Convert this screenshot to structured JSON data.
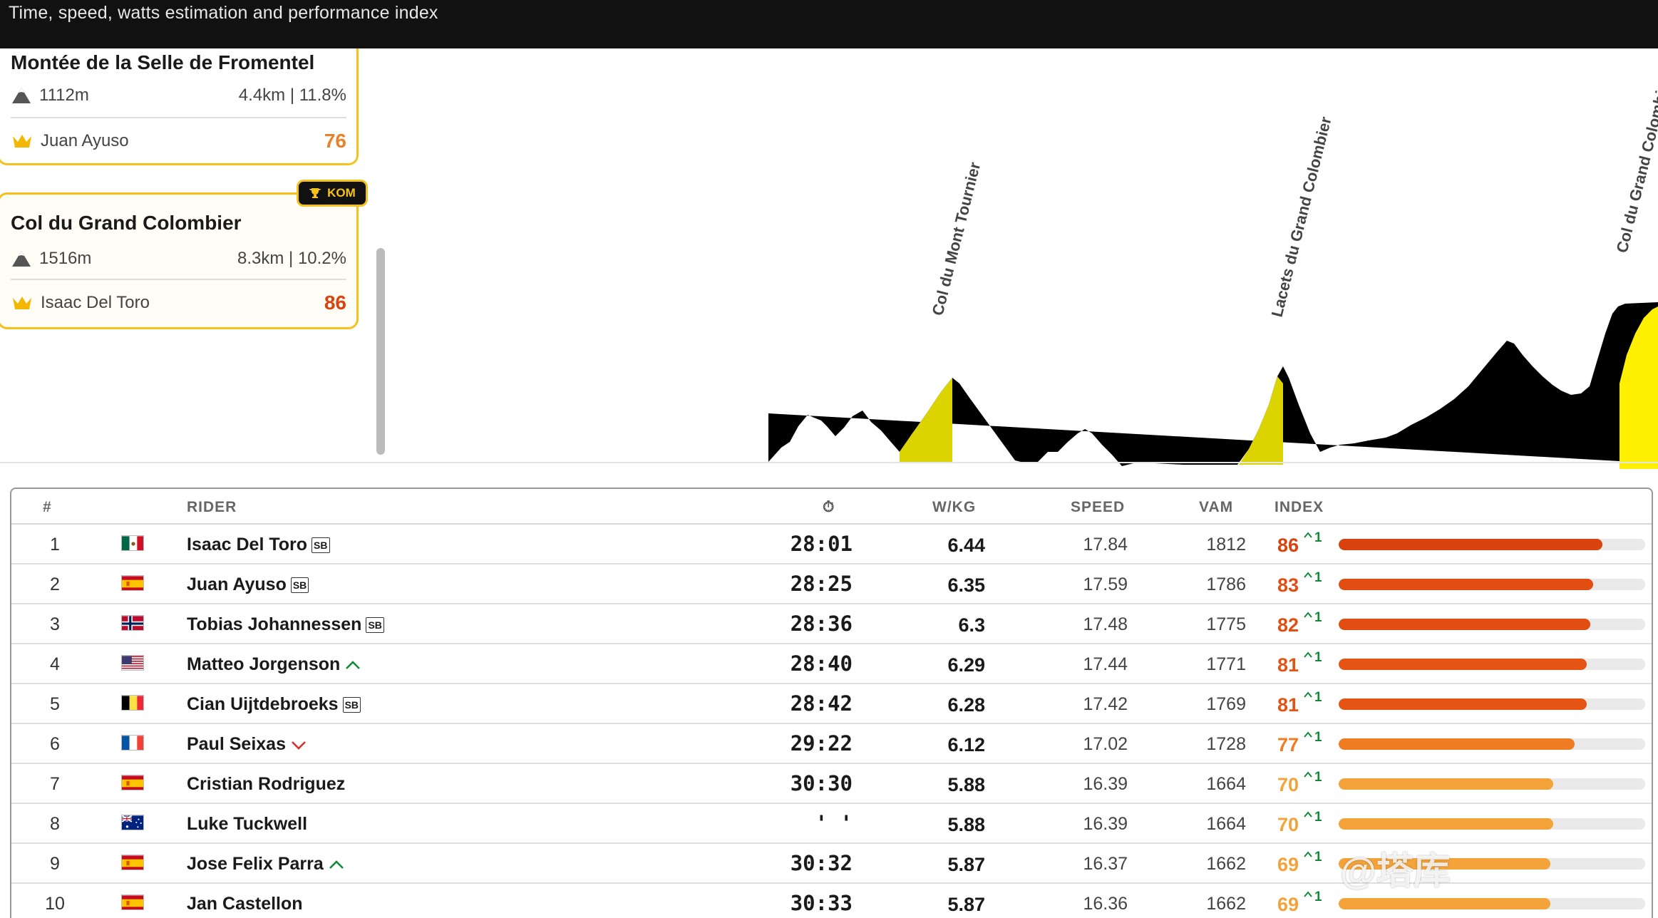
{
  "header": {
    "title": "Time, speed, watts estimation and performance index"
  },
  "climbs": [
    {
      "name": "Montée de la Selle de Fromentel",
      "altitude": "1112m",
      "stats": "4.4km | 11.8%",
      "leader": "Juan Ayuso",
      "score": "76",
      "score_color": "#e8832a"
    },
    {
      "name": "Col du Grand Colombier",
      "altitude": "1516m",
      "stats": "8.3km | 10.2%",
      "leader": "Isaac Del Toro",
      "score": "86",
      "score_color": "#d8430f",
      "badge": "KOM"
    }
  ],
  "profile": {
    "labels": [
      "Col du Mont Tournier",
      "Lacets du Grand Colombier",
      "Col du Grand Colombier"
    ]
  },
  "table": {
    "headers": {
      "pos": "#",
      "rider": "RIDER",
      "time": "⏱",
      "wkg": "W/KG",
      "speed": "SPEED",
      "vam": "VAM",
      "index": "INDEX"
    },
    "rows": [
      {
        "pos": "1",
        "flag": "mexico",
        "rider": "Isaac Del Toro",
        "tag": "sb",
        "time": "28:01",
        "wkg": "6.44",
        "speed": "17.84",
        "vam": "1812",
        "index": "86",
        "delta": "1",
        "bar": 0.86,
        "color": "#d8430f"
      },
      {
        "pos": "2",
        "flag": "spain",
        "rider": "Juan Ayuso",
        "tag": "sb",
        "time": "28:25",
        "wkg": "6.35",
        "speed": "17.59",
        "vam": "1786",
        "index": "83",
        "delta": "1",
        "bar": 0.83,
        "color": "#e24d12"
      },
      {
        "pos": "3",
        "flag": "norway",
        "rider": "Tobias Johannessen",
        "tag": "sb",
        "time": "28:36",
        "wkg": "6.3",
        "speed": "17.48",
        "vam": "1775",
        "index": "82",
        "delta": "1",
        "bar": 0.82,
        "color": "#e24d12"
      },
      {
        "pos": "4",
        "flag": "usa",
        "rider": "Matteo Jorgenson",
        "tag": "up",
        "time": "28:40",
        "wkg": "6.29",
        "speed": "17.44",
        "vam": "1771",
        "index": "81",
        "delta": "1",
        "bar": 0.81,
        "color": "#e45515"
      },
      {
        "pos": "5",
        "flag": "belgium",
        "rider": "Cian Uijtdebroeks",
        "tag": "sb",
        "time": "28:42",
        "wkg": "6.28",
        "speed": "17.42",
        "vam": "1769",
        "index": "81",
        "delta": "1",
        "bar": 0.81,
        "color": "#e45515"
      },
      {
        "pos": "6",
        "flag": "france",
        "rider": "Paul Seixas",
        "tag": "down",
        "time": "29:22",
        "wkg": "6.12",
        "speed": "17.02",
        "vam": "1728",
        "index": "77",
        "delta": "1",
        "bar": 0.77,
        "color": "#ef7b22"
      },
      {
        "pos": "7",
        "flag": "spain",
        "rider": "Cristian Rodriguez",
        "tag": "",
        "time": "30:30",
        "wkg": "5.88",
        "speed": "16.39",
        "vam": "1664",
        "index": "70",
        "delta": "1",
        "bar": 0.7,
        "color": "#f3a33a"
      },
      {
        "pos": "8",
        "flag": "australia",
        "rider": "Luke Tuckwell",
        "tag": "",
        "time": "' '",
        "wkg": "5.88",
        "speed": "16.39",
        "vam": "1664",
        "index": "70",
        "delta": "1",
        "bar": 0.7,
        "color": "#f3a33a"
      },
      {
        "pos": "9",
        "flag": "spain",
        "rider": "Jose Felix Parra",
        "tag": "up",
        "time": "30:32",
        "wkg": "5.87",
        "speed": "16.37",
        "vam": "1662",
        "index": "69",
        "delta": "1",
        "bar": 0.69,
        "color": "#f3a33a"
      },
      {
        "pos": "10",
        "flag": "spain",
        "rider": "Jan Castellon",
        "tag": "",
        "time": "30:33",
        "wkg": "5.87",
        "speed": "16.36",
        "vam": "1662",
        "index": "69",
        "delta": "1",
        "bar": 0.69,
        "color": "#f3a33a"
      }
    ]
  },
  "watermark": "@塔库"
}
